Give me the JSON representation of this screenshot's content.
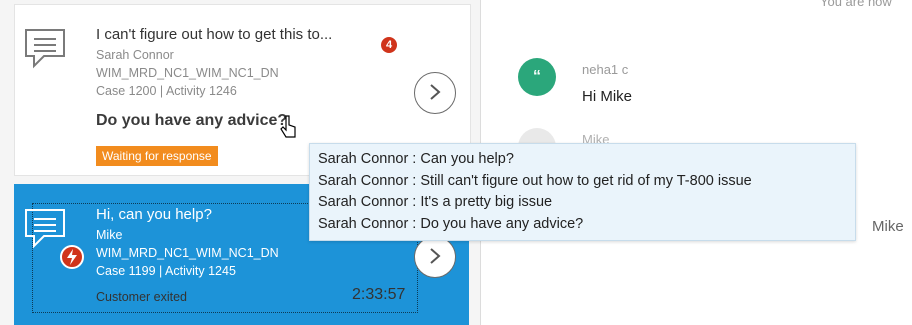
{
  "header": {
    "right_partial_text": "You are now"
  },
  "conversations": [
    {
      "title": "I can't figure out how to get this to...",
      "customer": "Sarah Connor",
      "queue": "WIM_MRD_NC1_WIM_NC1_DN",
      "case_activity": "Case 1200  |  Activity 1246",
      "last_message": "Do you have any advice?",
      "unread_count": "4",
      "status": "Waiting for response"
    },
    {
      "title": "Hi, can you help?",
      "customer": "Mike",
      "queue": "WIM_MRD_NC1_WIM_NC1_DN",
      "case_activity": "Case 1199  |  Activity 1245",
      "status": "Customer exited",
      "timer": "2:33:57"
    }
  ],
  "chat": {
    "messages": [
      {
        "avatar": "“",
        "sender": "neha1 c",
        "text": "Hi Mike"
      },
      {
        "sender": "Mike"
      }
    ],
    "right_label": "Mike"
  },
  "tooltip": {
    "lines": [
      "Sarah Connor : Can you help?",
      "Sarah Connor : Still can't figure out how to get rid of my T-800 issue",
      "Sarah Connor : It's a pretty big issue",
      "Sarah Connor : Do you have any advice?"
    ]
  },
  "colors": {
    "selected": "#1d93d8",
    "status_orange": "#f28c1e",
    "badge_red": "#d0341b",
    "avatar_green": "#2ba77b"
  }
}
